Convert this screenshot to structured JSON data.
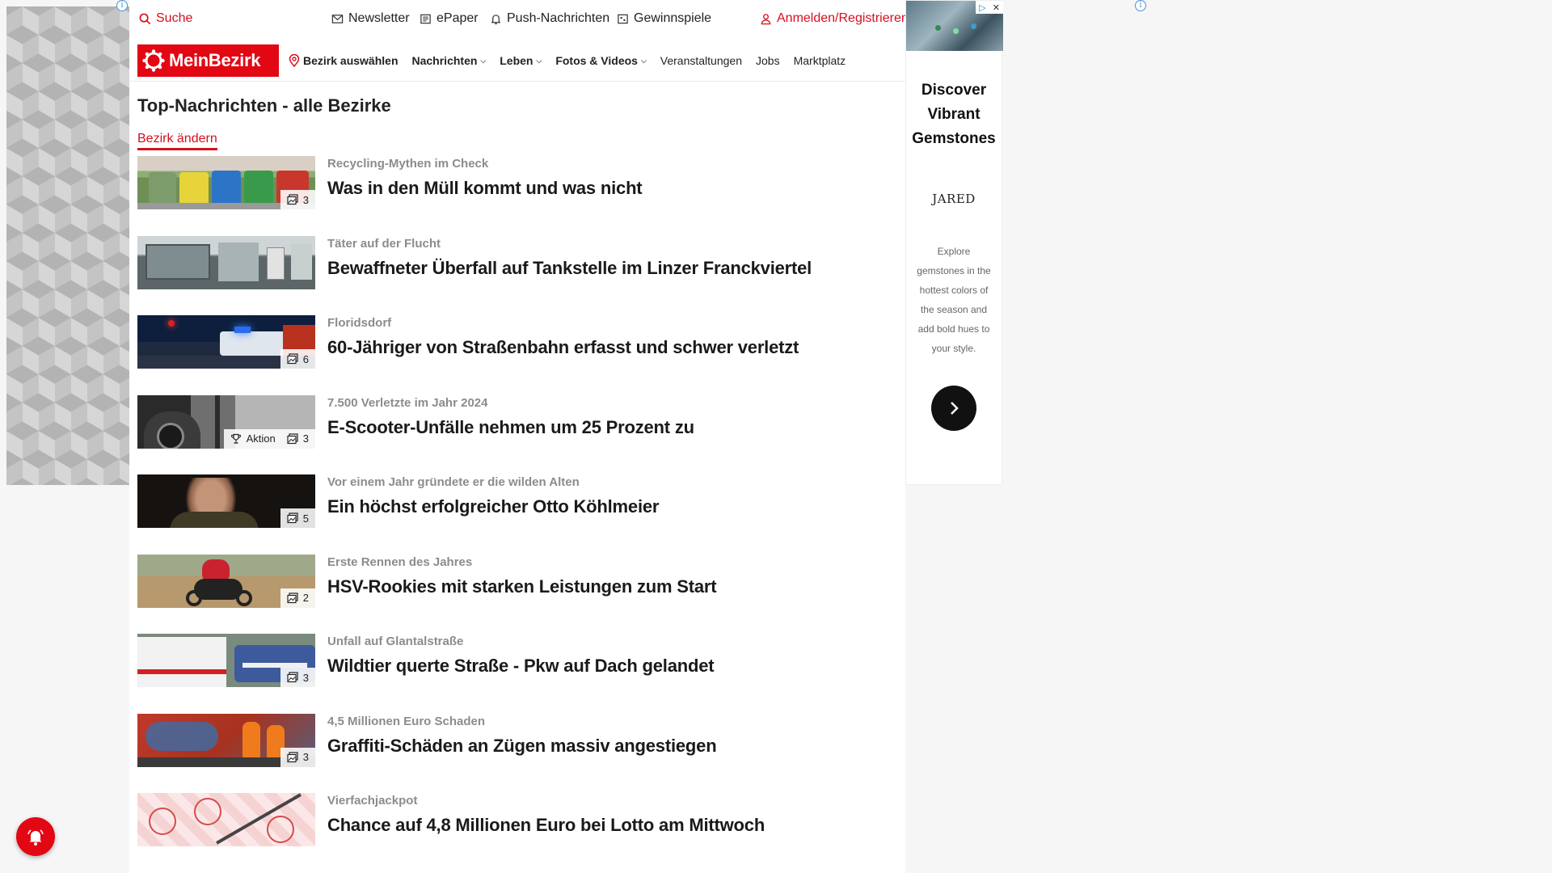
{
  "topbar": {
    "search": "Suche",
    "newsletter": "Newsletter",
    "epaper": "ePaper",
    "push": "Push-Nachrichten",
    "games": "Gewinnspiele",
    "login": "Anmelden/Registrieren"
  },
  "nav": {
    "logo": "MeinBezirk",
    "select_district": "Bezirk auswählen",
    "items": [
      "Nachrichten",
      "Leben",
      "Fotos & Videos",
      "Veranstaltungen",
      "Jobs",
      "Marktplatz"
    ]
  },
  "page": {
    "title": "Top-Nachrichten - alle Bezirke",
    "change_link": "Bezirk ändern"
  },
  "articles": [
    {
      "kicker": "Recycling-Mythen im Check",
      "headline": "Was in den Müll kommt und was nicht",
      "photos": "3",
      "aktion": ""
    },
    {
      "kicker": "Täter auf der Flucht",
      "headline": "Bewaffneter Überfall auf Tankstelle im Linzer Franckviertel",
      "photos": "",
      "aktion": ""
    },
    {
      "kicker": "Floridsdorf",
      "headline": "60-Jähriger von Straßenbahn erfasst und schwer verletzt",
      "photos": "6",
      "aktion": ""
    },
    {
      "kicker": "7.500 Verletzte im Jahr 2024",
      "headline": "E-Scooter-Unfälle nehmen um 25 Prozent zu",
      "photos": "3",
      "aktion": "Aktion"
    },
    {
      "kicker": "Vor einem Jahr gründete er die wilden Alten",
      "headline": "Ein höchst erfolgreicher Otto Köhlmeier",
      "photos": "5",
      "aktion": ""
    },
    {
      "kicker": "Erste Rennen des Jahres",
      "headline": "HSV-Rookies mit starken Leistungen zum Start",
      "photos": "2",
      "aktion": ""
    },
    {
      "kicker": "Unfall auf Glantalstraße",
      "headline": "Wildtier querte Straße - Pkw auf Dach gelandet",
      "photos": "3",
      "aktion": ""
    },
    {
      "kicker": "4,5 Millionen Euro Schaden",
      "headline": "Graffiti-Schäden an Zügen massiv angestiegen",
      "photos": "3",
      "aktion": ""
    },
    {
      "kicker": "Vierfachjackpot",
      "headline": "Chance auf 4,8 Millionen Euro bei Lotto am Mittwoch",
      "photos": "",
      "aktion": ""
    }
  ],
  "ad": {
    "title_lines": [
      "Discover",
      "Vibrant",
      "Gemstones"
    ],
    "brand": "JARED",
    "text": "Explore gemstones in the hottest colors of the season and add bold hues to your style."
  },
  "colors": {
    "brand_red": "#e30613",
    "link_red": "#d50f1d",
    "kicker_gray": "#8c8c8c"
  }
}
